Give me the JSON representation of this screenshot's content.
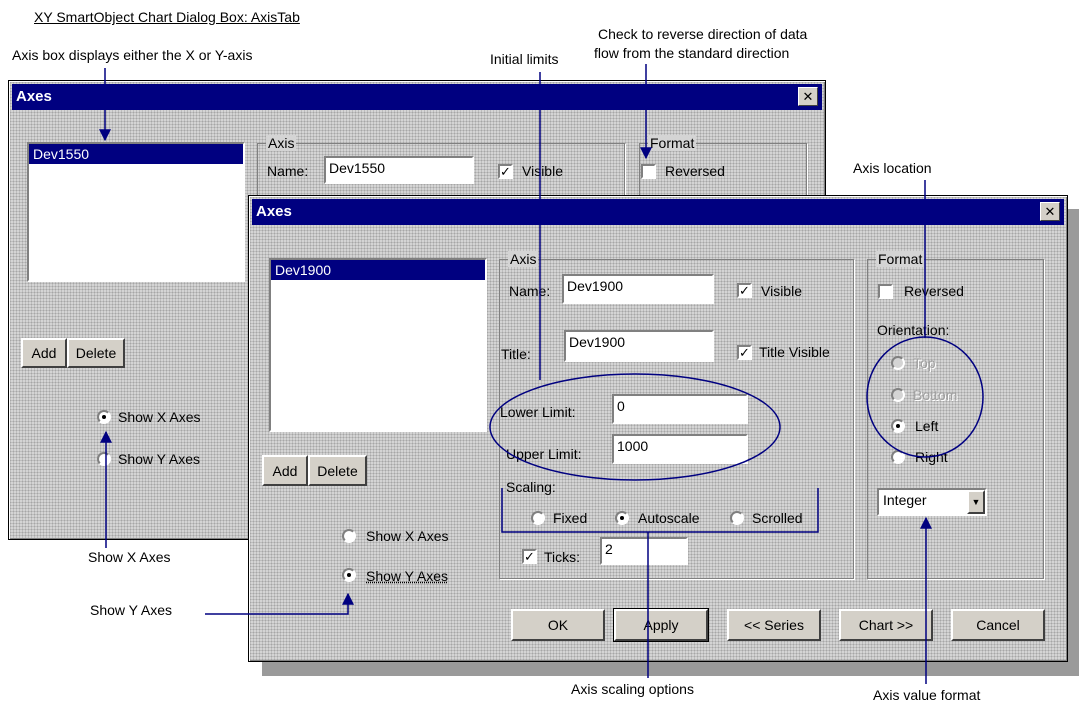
{
  "annotations": {
    "caption": "XY SmartObject Chart Dialog Box: AxisTab",
    "axis_box": "Axis box displays either the X or Y-axis",
    "initial_limits": "Initial limits",
    "reverse_line1": "Check to reverse direction of data",
    "reverse_line2": "flow from the standard direction",
    "axis_location": "Axis location",
    "show_x": "Show X Axes",
    "show_y": "Show Y Axes",
    "scaling_options": "Axis scaling options",
    "value_format": "Axis value format"
  },
  "back_dialog": {
    "title": "Axes",
    "close": "✕",
    "list_items": [
      "Dev1550"
    ],
    "axis_group": "Axis",
    "name_label": "Name:",
    "name_value": "Dev1550",
    "visible_label": "Visible",
    "visible_checked": true,
    "format_group": "Format",
    "reversed_label": "Reversed",
    "reversed_checked": false,
    "add": "Add",
    "delete": "Delete",
    "show_x": "Show X Axes",
    "show_y": "Show Y Axes",
    "selected_view": "x"
  },
  "front_dialog": {
    "title": "Axes",
    "close": "✕",
    "list_items": [
      "Dev1900"
    ],
    "add": "Add",
    "delete": "Delete",
    "show_x": "Show X Axes",
    "show_y": "Show Y Axes",
    "selected_view": "y",
    "axis_group": "Axis",
    "name_label": "Name:",
    "name_value": "Dev1900",
    "visible_label": "Visible",
    "visible_checked": true,
    "title_label": "Title:",
    "title_value": "Dev1900",
    "title_visible_label": "Title Visible",
    "title_visible_checked": true,
    "lower_label": "Lower Limit:",
    "lower_value": "0",
    "upper_label": "Upper Limit:",
    "upper_value": "1000",
    "scaling_label": "Scaling:",
    "scaling_options": [
      "Fixed",
      "Autoscale",
      "Scrolled"
    ],
    "scaling_selected": "Autoscale",
    "ticks_label": "Ticks:",
    "ticks_checked": true,
    "ticks_value": "2",
    "format_group": "Format",
    "reversed_label": "Reversed",
    "reversed_checked": false,
    "orientation_label": "Orientation:",
    "orientation_options": [
      "Top",
      "Bottom",
      "Left",
      "Right"
    ],
    "orientation_selected": "Left",
    "format_value": "Integer",
    "buttons": {
      "ok": "OK",
      "apply": "Apply",
      "series": "<< Series",
      "chart": "Chart >>",
      "cancel": "Cancel"
    }
  },
  "colors": {
    "titlebar": "#000080",
    "annotation_line": "#000080",
    "dialog_face": "#d4d4d4"
  }
}
